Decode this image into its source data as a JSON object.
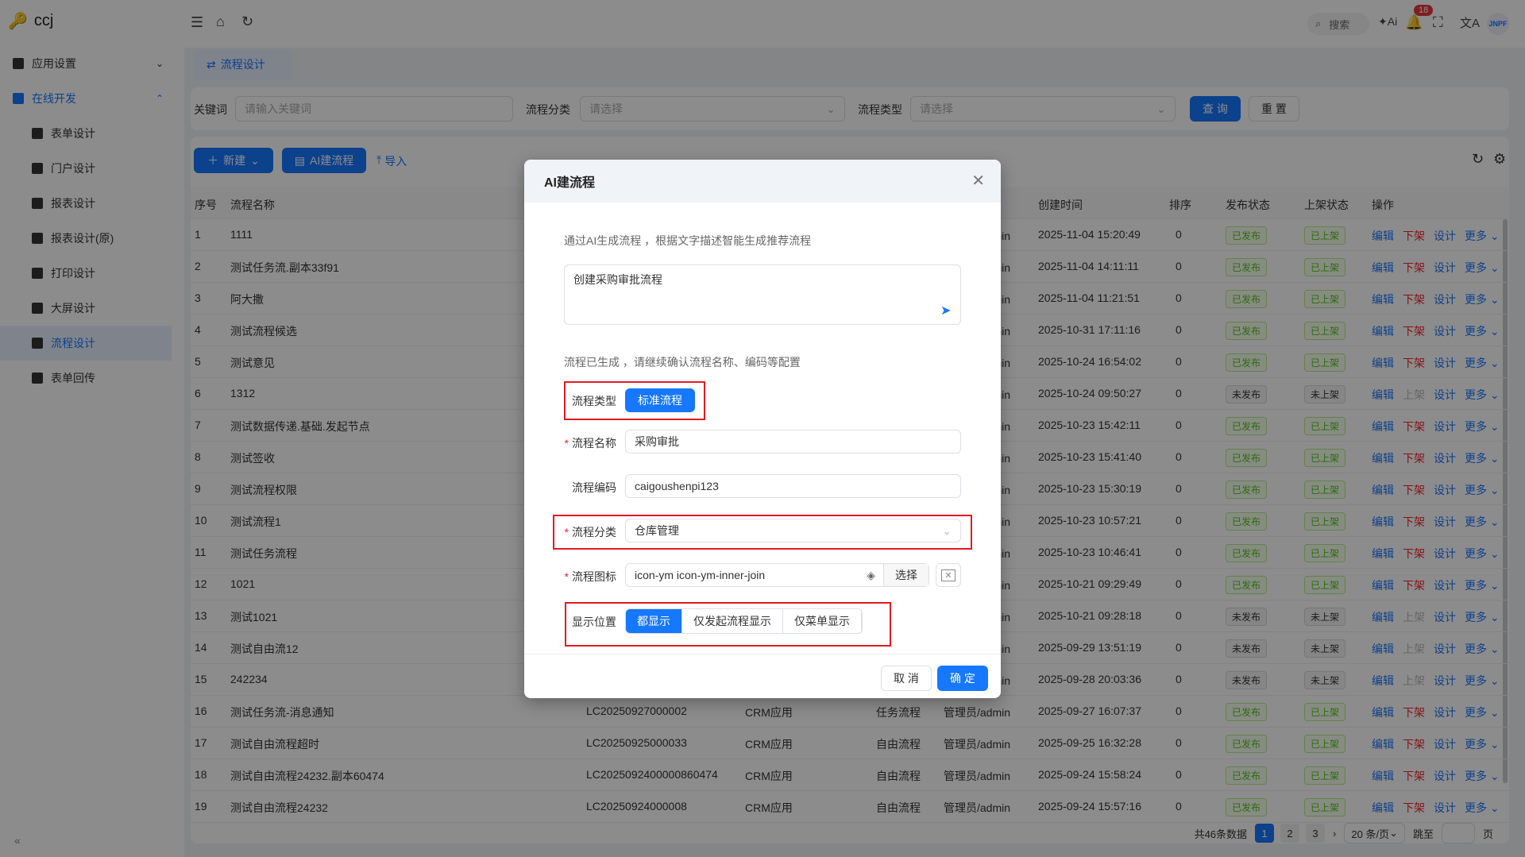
{
  "app": {
    "title": "ccj"
  },
  "sidebar": {
    "items": [
      {
        "label": "应用设置",
        "icon": "grid-icon",
        "expanded": false
      },
      {
        "label": "在线开发",
        "icon": "terminal-icon",
        "expanded": true,
        "active": true
      },
      {
        "label": "表单设计",
        "icon": "form-icon"
      },
      {
        "label": "门户设计",
        "icon": "portal-icon"
      },
      {
        "label": "报表设计",
        "icon": "chart-icon"
      },
      {
        "label": "报表设计(原)",
        "icon": "chart-icon"
      },
      {
        "label": "打印设计",
        "icon": "print-icon"
      },
      {
        "label": "大屏设计",
        "icon": "screen-icon"
      },
      {
        "label": "流程设计",
        "icon": "flow-icon",
        "selected": true
      },
      {
        "label": "表单回传",
        "icon": "form-return-icon"
      }
    ]
  },
  "topbar": {
    "search_label": "搜索",
    "notification_count": "18",
    "avatar_text": "JNPF"
  },
  "tab": {
    "label": "流程设计"
  },
  "filters": {
    "keyword_label": "关键词",
    "keyword_placeholder": "请输入关键词",
    "category_label": "流程分类",
    "category_placeholder": "请选择",
    "type_label": "流程类型",
    "type_placeholder": "请选择",
    "query": "查 询",
    "reset": "重 置"
  },
  "toolbar": {
    "new": "新建",
    "ai": "AI建流程",
    "import": "导入"
  },
  "table": {
    "headers": {
      "index": "序号",
      "name": "流程名称",
      "created": "创建时间",
      "sort": "排序",
      "publish": "发布状态",
      "shelf": "上架状态",
      "ops": "操作"
    },
    "op_labels": {
      "edit": "编辑",
      "off": "下架",
      "on": "上架",
      "design": "设计",
      "more": "更多"
    },
    "rows": [
      {
        "i": "1",
        "name": "1111",
        "code": "",
        "app": "",
        "type": "",
        "creator": "管理员/admin",
        "time": "2025-11-04 15:20:49",
        "sort": "0",
        "pub": "已发布",
        "shelf": "已上架"
      },
      {
        "i": "2",
        "name": "测试任务流.副本33f91",
        "code": "",
        "app": "",
        "type": "",
        "creator": "管理员/admin",
        "time": "2025-11-04 14:11:11",
        "sort": "0",
        "pub": "已发布",
        "shelf": "已上架"
      },
      {
        "i": "3",
        "name": "阿大撒",
        "code": "",
        "app": "",
        "type": "",
        "creator": "管理员/admin",
        "time": "2025-11-04 11:21:51",
        "sort": "0",
        "pub": "已发布",
        "shelf": "已上架"
      },
      {
        "i": "4",
        "name": "测试流程候选",
        "code": "",
        "app": "",
        "type": "",
        "creator": "管理员/admin",
        "time": "2025-10-31 17:11:16",
        "sort": "0",
        "pub": "已发布",
        "shelf": "已上架"
      },
      {
        "i": "5",
        "name": "测试意见",
        "code": "",
        "app": "",
        "type": "",
        "creator": "管理员/admin",
        "time": "2025-10-24 16:54:02",
        "sort": "0",
        "pub": "已发布",
        "shelf": "已上架"
      },
      {
        "i": "6",
        "name": "1312",
        "code": "",
        "app": "",
        "type": "",
        "creator": "管理员/admin",
        "time": "2025-10-24 09:50:27",
        "sort": "0",
        "pub": "未发布",
        "shelf": "未上架"
      },
      {
        "i": "7",
        "name": "测试数据传递.基础.发起节点",
        "code": "",
        "app": "",
        "type": "",
        "creator": "管理员/admin",
        "time": "2025-10-23 15:42:11",
        "sort": "0",
        "pub": "已发布",
        "shelf": "已上架"
      },
      {
        "i": "8",
        "name": "测试签收",
        "code": "",
        "app": "",
        "type": "",
        "creator": "管理员/admin",
        "time": "2025-10-23 15:41:40",
        "sort": "0",
        "pub": "已发布",
        "shelf": "已上架"
      },
      {
        "i": "9",
        "name": "测试流程权限",
        "code": "",
        "app": "",
        "type": "",
        "creator": "管理员/admin",
        "time": "2025-10-23 15:30:19",
        "sort": "0",
        "pub": "已发布",
        "shelf": "已上架"
      },
      {
        "i": "10",
        "name": "测试流程1",
        "code": "",
        "app": "",
        "type": "",
        "creator": "管理员/admin",
        "time": "2025-10-23 10:57:21",
        "sort": "0",
        "pub": "已发布",
        "shelf": "已上架"
      },
      {
        "i": "11",
        "name": "测试任务流程",
        "code": "",
        "app": "",
        "type": "",
        "creator": "管理员/admin",
        "time": "2025-10-23 10:46:41",
        "sort": "0",
        "pub": "已发布",
        "shelf": "已上架"
      },
      {
        "i": "12",
        "name": "1021",
        "code": "",
        "app": "",
        "type": "",
        "creator": "管理员/admin",
        "time": "2025-10-21 09:29:49",
        "sort": "0",
        "pub": "已发布",
        "shelf": "已上架"
      },
      {
        "i": "13",
        "name": "测试1021",
        "code": "",
        "app": "",
        "type": "",
        "creator": "管理员/admin",
        "time": "2025-10-21 09:28:18",
        "sort": "0",
        "pub": "未发布",
        "shelf": "未上架"
      },
      {
        "i": "14",
        "name": "测试自由流12",
        "code": "",
        "app": "",
        "type": "",
        "creator": "管理员/admin",
        "time": "2025-09-29 13:51:19",
        "sort": "0",
        "pub": "未发布",
        "shelf": "未上架"
      },
      {
        "i": "15",
        "name": "242234",
        "code": "",
        "app": "",
        "type": "",
        "creator": "管理员/admin",
        "time": "2025-09-28 20:03:36",
        "sort": "0",
        "pub": "未发布",
        "shelf": "未上架"
      },
      {
        "i": "16",
        "name": "测试任务流-消息通知",
        "code": "LC20250927000002",
        "app": "CRM应用",
        "type": "任务流程",
        "creator": "管理员/admin",
        "time": "2025-09-27 16:07:37",
        "sort": "0",
        "pub": "已发布",
        "shelf": "已上架"
      },
      {
        "i": "17",
        "name": "测试自由流程超时",
        "code": "LC20250925000033",
        "app": "CRM应用",
        "type": "自由流程",
        "creator": "管理员/admin",
        "time": "2025-09-25 16:32:28",
        "sort": "0",
        "pub": "已发布",
        "shelf": "已上架"
      },
      {
        "i": "18",
        "name": "测试自由流程24232.副本60474",
        "code": "LC2025092400000860474",
        "app": "CRM应用",
        "type": "自由流程",
        "creator": "管理员/admin",
        "time": "2025-09-24 15:58:24",
        "sort": "0",
        "pub": "已发布",
        "shelf": "已上架"
      },
      {
        "i": "19",
        "name": "测试自由流程24232",
        "code": "LC20250924000008",
        "app": "CRM应用",
        "type": "自由流程",
        "creator": "管理员/admin",
        "time": "2025-09-24 15:57:16",
        "sort": "0",
        "pub": "已发布",
        "shelf": "已上架"
      }
    ]
  },
  "pagination": {
    "total": "共46条数据",
    "pages": [
      "1",
      "2",
      "3"
    ],
    "current": "1",
    "page_size": "20 条/页",
    "jump_label": "跳至",
    "page_suffix": "页"
  },
  "modal": {
    "title": "AI建流程",
    "intro": "通过AI生成流程 ，根据文字描述智能生成推荐流程",
    "prompt": "创建采购审批流程",
    "generated_note": "流程已生成 ，请继续确认流程名称、编码等配置",
    "type_label": "流程类型",
    "type_value": "标准流程",
    "name_label": "流程名称",
    "name_value": "采购审批",
    "code_label": "流程编码",
    "code_value": "caigoushenpi123",
    "category_label": "流程分类",
    "category_value": "仓库管理",
    "icon_label": "流程图标",
    "icon_value": "icon-ym icon-ym-inner-join",
    "icon_select": "选择",
    "display_label": "显示位置",
    "display_options": [
      "都显示",
      "仅发起流程显示",
      "仅菜单显示"
    ],
    "display_selected": "都显示",
    "cancel": "取 消",
    "ok": "确 定"
  },
  "colors": {
    "primary": "#1677ff",
    "danger": "#f5222d",
    "highlight_box": "#e01b24"
  }
}
